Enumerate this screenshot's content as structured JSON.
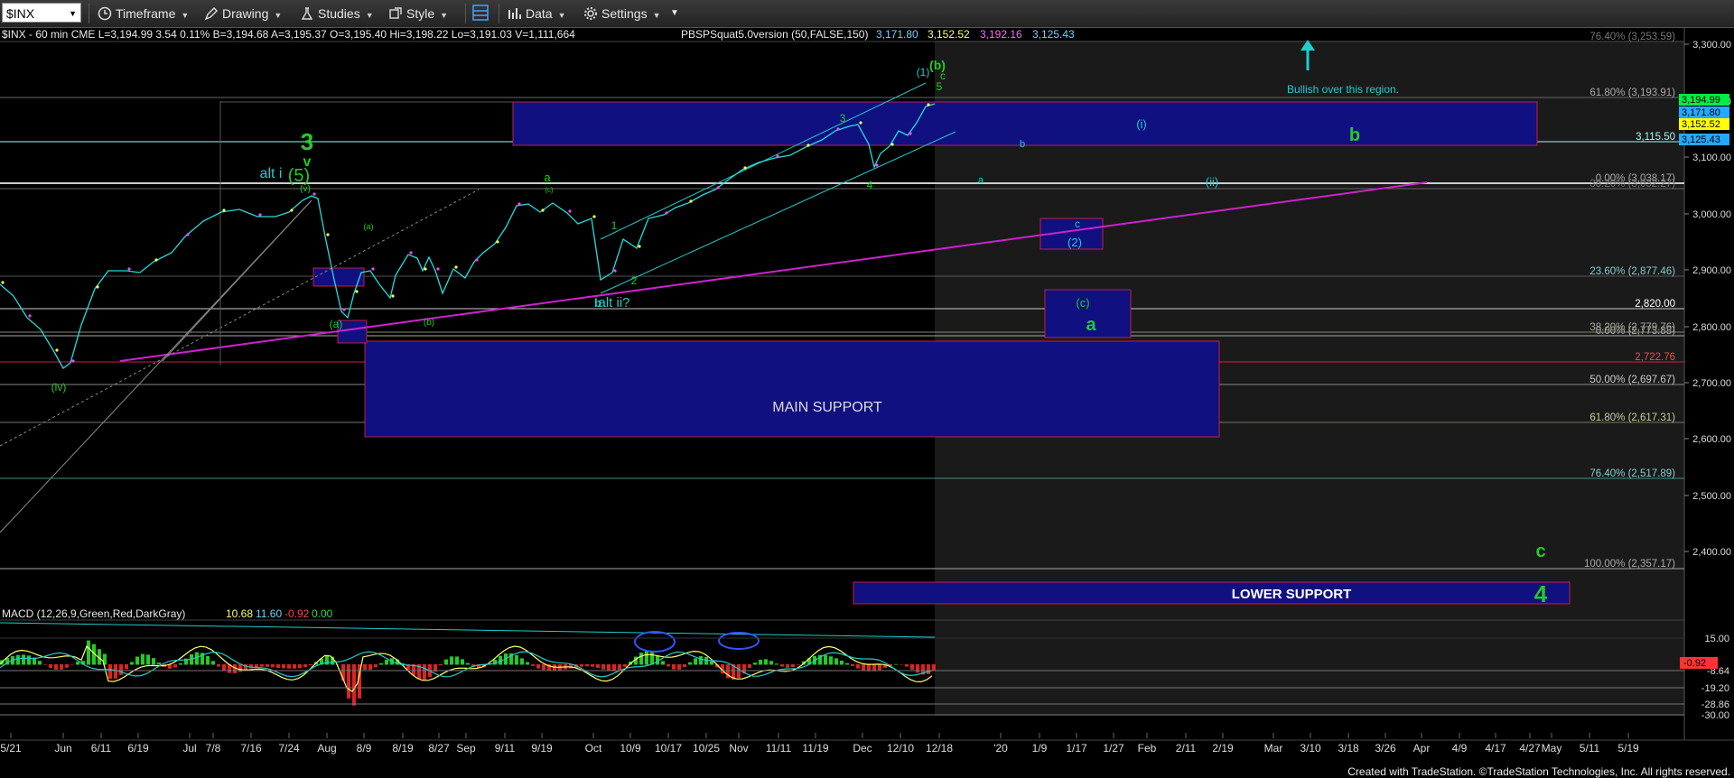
{
  "toolbar": {
    "symbol": "$INX",
    "timeframe": "Timeframe",
    "drawing": "Drawing",
    "studies": "Studies",
    "style": "Style",
    "data": "Data",
    "settings": "Settings"
  },
  "header": {
    "quote_line": "$INX - 60 min  CME  L=3,194.99  3.54    0.11%  B=3,194.68  A=3,195.37  O=3,195.40  Hi=3,198.22  Lo=3,191.03  V=1,111,664",
    "study_name": "PBSPSquat5.0version (50,FALSE,150)",
    "study_vals": [
      {
        "text": "3,171.80",
        "color": "#6fd3ff"
      },
      {
        "text": "3,152.52",
        "color": "#ffff66"
      },
      {
        "text": "3,192.16",
        "color": "#ff66ff"
      },
      {
        "text": "3,125.43",
        "color": "#6fd3ff"
      }
    ]
  },
  "price_axis": {
    "ticks": [
      "3,300.00",
      "3,200.00",
      "3,100.00",
      "3,000.00",
      "2,900.00",
      "2,800.00",
      "2,700.00",
      "2,600.00",
      "2,500.00",
      "2,400.00"
    ],
    "tags": [
      {
        "text": "3,194.99",
        "bg": "#00ee44",
        "fg": "#000"
      },
      {
        "text": "3,171.80",
        "bg": "#22aaff",
        "fg": "#000"
      },
      {
        "text": "3,152.52",
        "bg": "#ffff00",
        "fg": "#000"
      },
      {
        "text": "3,125.43",
        "bg": "#22aaff",
        "fg": "#000"
      }
    ]
  },
  "fib_labels": [
    {
      "text": "76.40% (3,253.59)",
      "color": "#777"
    },
    {
      "text": "61.80% (3,193.91)",
      "color": "#aaa"
    },
    {
      "text": "3,115.50",
      "color": "#9fe"
    },
    {
      "text": "0.00% (3,038.17)",
      "color": "#aaa"
    },
    {
      "text": "38.20% (3,032.27)",
      "color": "#777"
    },
    {
      "text": "23.60% (2,877.46)",
      "color": "#8cc"
    },
    {
      "text": "2,820.00",
      "color": "#fff"
    },
    {
      "text": "38.20% (2,779.76)",
      "color": "#aa9"
    },
    {
      "text": "0.00% (2,773.88)",
      "color": "#aaa"
    },
    {
      "text": "2,722.76",
      "color": "#ff4444"
    },
    {
      "text": "50.00% (2,697.67)",
      "color": "#ccc"
    },
    {
      "text": "61.80% (2,617.31)",
      "color": "#cc9"
    },
    {
      "text": "76.40% (2,517.89)",
      "color": "#8cc"
    },
    {
      "text": "100.00% (2,357.17)",
      "color": "#aaa"
    }
  ],
  "zones": {
    "main_support": "MAIN SUPPORT",
    "lower_support": "LOWER SUPPORT",
    "bullish_note": "Bullish over this region."
  },
  "wave_labels": [
    {
      "text": "3",
      "color": "#22cc22"
    },
    {
      "text": "v",
      "color": "#22cc22"
    },
    {
      "text": "(5)",
      "color": "#22cc22"
    },
    {
      "text": "alt i",
      "color": "#22cccc"
    },
    {
      "text": "(iv)",
      "color": "#22cc22"
    },
    {
      "text": "(v)",
      "color": "#22cc22"
    },
    {
      "text": "(a)",
      "color": "#22cc22"
    },
    {
      "text": "(a)",
      "color": "#22cc22"
    },
    {
      "text": "(b)",
      "color": "#22cc22"
    },
    {
      "text": "a",
      "color": "#22cc22"
    },
    {
      "text": "(c)",
      "color": "#22cc22"
    },
    {
      "text": "b",
      "color": "#22cccc"
    },
    {
      "text": "alt ii?",
      "color": "#22cccc"
    },
    {
      "text": "1",
      "color": "#22cc22"
    },
    {
      "text": "2",
      "color": "#22cc22"
    },
    {
      "text": "3",
      "color": "#22cc22"
    },
    {
      "text": "4",
      "color": "#22cc22"
    },
    {
      "text": "5",
      "color": "#22cc22"
    },
    {
      "text": "(1)",
      "color": "#22cccc"
    },
    {
      "text": "c",
      "color": "#22cc22"
    },
    {
      "text": "(b)",
      "color": "#22cc22"
    },
    {
      "text": "a",
      "color": "#22cccc"
    },
    {
      "text": "b",
      "color": "#22cccc"
    },
    {
      "text": "(i)",
      "color": "#22cccc"
    },
    {
      "text": "(ii)",
      "color": "#22cccc"
    },
    {
      "text": "b",
      "color": "#22cc22"
    },
    {
      "text": "c",
      "color": "#22cccc"
    },
    {
      "text": "(2)",
      "color": "#22cccc"
    },
    {
      "text": "(c)",
      "color": "#22cc22"
    },
    {
      "text": "a",
      "color": "#22cc22"
    },
    {
      "text": "c",
      "color": "#22cc22"
    },
    {
      "text": "4",
      "color": "#22cc22"
    }
  ],
  "macd": {
    "title": "MACD (12,26,9,Green,Red,DarkGray)",
    "vals": [
      {
        "text": "10.68",
        "color": "#ffff66"
      },
      {
        "text": "11.60",
        "color": "#6fd3ff"
      },
      {
        "text": "-0.92",
        "color": "#ff4444"
      },
      {
        "text": "0.00",
        "color": "#33dd33"
      }
    ],
    "ticks": [
      "15.00",
      "-8.64",
      "-19.20",
      "-28.86",
      "-30.00"
    ],
    "tag": {
      "text": "-0.92",
      "bg": "#ff3333",
      "fg": "#000"
    }
  },
  "date_axis": [
    "5/21",
    "Jun",
    "6/11",
    "6/19",
    "Jul",
    "7/8",
    "7/16",
    "7/24",
    "Aug",
    "8/9",
    "8/19",
    "8/27",
    "Sep",
    "9/11",
    "9/19",
    "Oct",
    "10/9",
    "10/17",
    "10/25",
    "Nov",
    "11/11",
    "11/19",
    "Dec",
    "12/10",
    "12/18",
    "'20",
    "1/9",
    "1/17",
    "1/27",
    "Feb",
    "2/11",
    "2/19",
    "Mar",
    "3/10",
    "3/18",
    "3/26",
    "Apr",
    "4/9",
    "4/17",
    "4/27",
    "May",
    "5/11",
    "5/19"
  ],
  "footer": "Created with TradeStation. ©TradeStation Technologies, Inc. All rights reserved.",
  "colors": {
    "accent": "#1c1c8a",
    "magenta": "#cc22cc",
    "cyan": "#22cccc",
    "green": "#22cc22"
  }
}
